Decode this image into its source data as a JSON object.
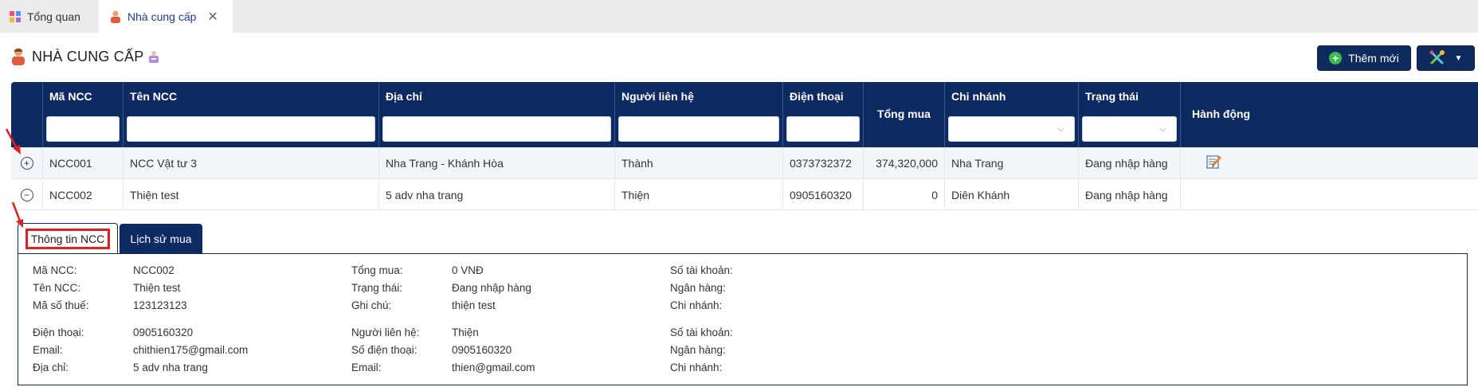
{
  "top_tabs": [
    {
      "label": "Tổng quan"
    },
    {
      "label": "Nhà cung cấp"
    }
  ],
  "page": {
    "title": "NHÀ CUNG CẤP"
  },
  "toolbar": {
    "add_label": "Thêm mới"
  },
  "table": {
    "columns": [
      "Mã NCC",
      "Tên NCC",
      "Địa chỉ",
      "Người liên hệ",
      "Điện thoại",
      "Tổng mua",
      "Chi nhánh",
      "Trạng thái",
      "Hành động"
    ],
    "rows": [
      {
        "expander": "+",
        "code": "NCC001",
        "name": "NCC Vật tư 3",
        "address": "Nha Trang - Khánh Hòa",
        "contact": "Thành",
        "phone": "0373732372",
        "total": "374,320,000",
        "branch": "Nha Trang",
        "status": "Đang nhập hàng"
      },
      {
        "expander": "−",
        "code": "NCC002",
        "name": "Thiện test",
        "address": "5 adv nha trang",
        "contact": "Thiện",
        "phone": "0905160320",
        "total": "0",
        "branch": "Diên Khánh",
        "status": "Đang nhập hàng"
      }
    ]
  },
  "detail_tabs": [
    {
      "label": "Thông tin NCC"
    },
    {
      "label": "Lịch sử mua"
    }
  ],
  "detail": {
    "col1": [
      {
        "k": "Mã NCC:",
        "v": "NCC002"
      },
      {
        "k": "Tên NCC:",
        "v": "Thiện test"
      },
      {
        "k": "Mã số thuế:",
        "v": "123123123"
      },
      {
        "k": "Điện thoại:",
        "v": "0905160320"
      },
      {
        "k": "Email:",
        "v": "chithien175@gmail.com"
      },
      {
        "k": "Địa chỉ:",
        "v": "5 adv nha trang"
      }
    ],
    "col2": [
      {
        "k": "Tổng mua:",
        "v": "0 VNĐ"
      },
      {
        "k": "Trạng thái:",
        "v": "Đang nhập hàng"
      },
      {
        "k": "Ghi chú:",
        "v": "thiện test"
      },
      {
        "k": "Người liên hệ:",
        "v": "Thiện"
      },
      {
        "k": "Số điện thoại:",
        "v": "0905160320"
      },
      {
        "k": "Email:",
        "v": "thien@gmail.com"
      }
    ],
    "col3": [
      {
        "k": "Số tài khoản:",
        "v": ""
      },
      {
        "k": "Ngân hàng:",
        "v": ""
      },
      {
        "k": "Chi nhánh:",
        "v": ""
      },
      {
        "k": "Số tài khoản:",
        "v": ""
      },
      {
        "k": "Ngân hàng:",
        "v": ""
      },
      {
        "k": "Chi nhánh:",
        "v": ""
      }
    ]
  }
}
